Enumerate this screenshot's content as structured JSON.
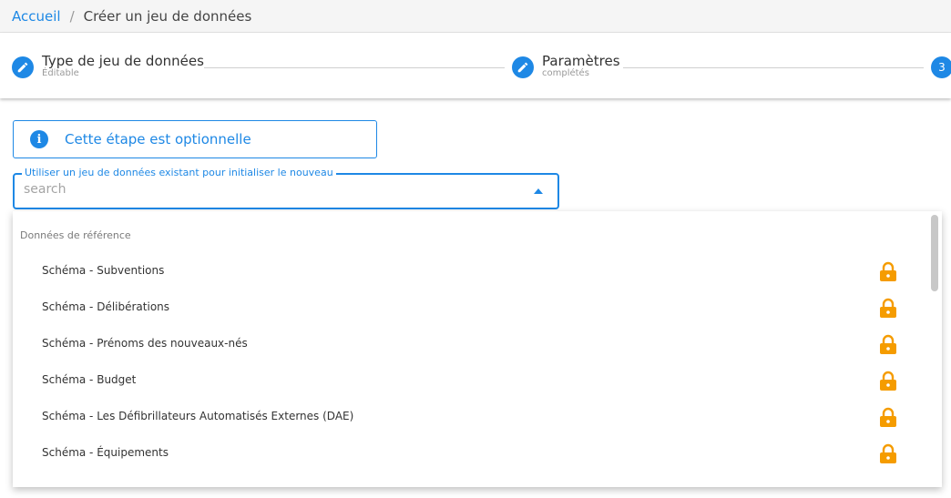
{
  "breadcrumb": {
    "home": "Accueil",
    "separator": "/",
    "current": "Créer un jeu de données"
  },
  "stepper": {
    "steps": [
      {
        "title": "Type de jeu de données",
        "subtitle": "Éditable",
        "icon": "pencil-icon"
      },
      {
        "title": "Paramètres",
        "subtitle": "complétés",
        "icon": "pencil-icon"
      },
      {
        "number": "3"
      }
    ]
  },
  "info": {
    "text": "Cette étape est optionnelle",
    "icon": "info-icon"
  },
  "select": {
    "label": "Utiliser un jeu de données existant pour initialiser le nouveau",
    "placeholder": "search",
    "value": ""
  },
  "dropdown": {
    "group_title": "Données de référence",
    "options": [
      {
        "label": "Schéma - Subventions",
        "icon": "lock-icon"
      },
      {
        "label": "Schéma - Délibérations",
        "icon": "lock-icon"
      },
      {
        "label": "Schéma - Prénoms des nouveaux-nés",
        "icon": "lock-icon"
      },
      {
        "label": "Schéma - Budget",
        "icon": "lock-icon"
      },
      {
        "label": "Schéma - Les Défibrillateurs Automatisés Externes (DAE)",
        "icon": "lock-icon"
      },
      {
        "label": "Schéma - Équipements",
        "icon": "lock-icon"
      }
    ]
  },
  "colors": {
    "primary": "#1e88e5",
    "lock": "#f59c00",
    "breadcrumb_bg": "#f5f5f5"
  }
}
